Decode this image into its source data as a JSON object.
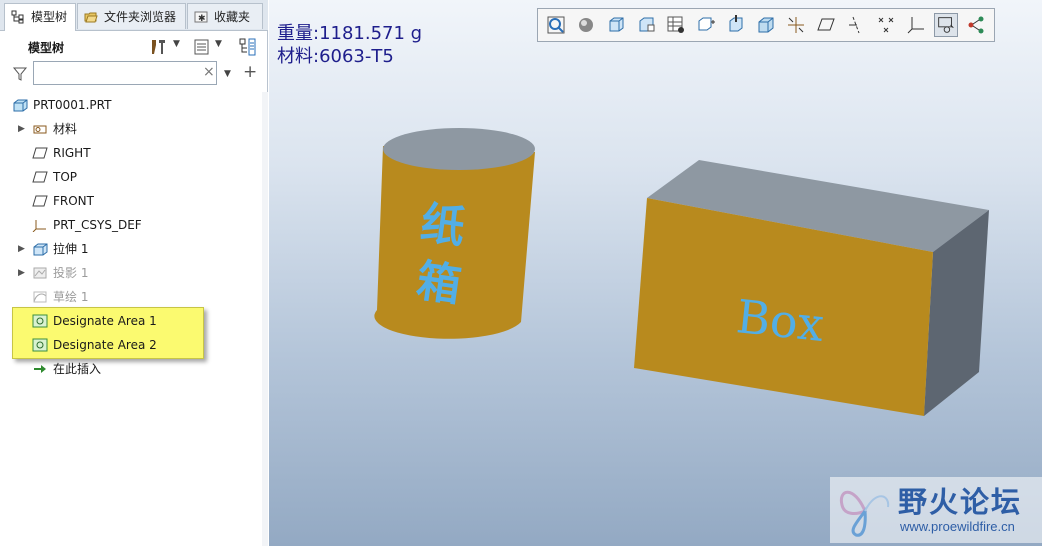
{
  "left_panel": {
    "tabs": [
      {
        "label": "模型树",
        "icon": "model-tree-icon"
      },
      {
        "label": "文件夹浏览器",
        "icon": "folder-browser-icon"
      },
      {
        "label": "收藏夹",
        "icon": "favorites-icon"
      }
    ],
    "header_title": "模型树",
    "toolbar_icons": [
      "settings-tools-icon",
      "tree-columns-icon",
      "tree-filter-display-icon"
    ],
    "search": {
      "value": "",
      "clear_symbol": "×"
    },
    "tree": {
      "root": "PRT0001.PRT",
      "items": [
        {
          "label": "材料",
          "icon": "material-icon",
          "expandable": true,
          "dim": false
        },
        {
          "label": "RIGHT",
          "icon": "datum-plane-icon",
          "expandable": false,
          "dim": false
        },
        {
          "label": "TOP",
          "icon": "datum-plane-icon",
          "expandable": false,
          "dim": false
        },
        {
          "label": "FRONT",
          "icon": "datum-plane-icon",
          "expandable": false,
          "dim": false
        },
        {
          "label": "PRT_CSYS_DEF",
          "icon": "coordinate-system-icon",
          "expandable": false,
          "dim": false
        },
        {
          "label": "拉伸 1",
          "icon": "extrude-icon",
          "expandable": true,
          "dim": false
        },
        {
          "label": "投影 1",
          "icon": "projection-icon",
          "expandable": true,
          "dim": true
        },
        {
          "label": "草绘 1",
          "icon": "sketch-icon",
          "expandable": false,
          "dim": true
        },
        {
          "label": "Designate Area 1",
          "icon": "designate-area-icon",
          "expandable": false,
          "dim": false,
          "highlighted": true
        },
        {
          "label": "Designate Area 2",
          "icon": "designate-area-icon",
          "expandable": false,
          "dim": false,
          "highlighted": true
        },
        {
          "label": "在此插入",
          "icon": "insert-here-arrow-icon",
          "expandable": false,
          "dim": false
        }
      ]
    }
  },
  "viewport": {
    "mass_label": "重量:1181.571 g",
    "material_label": "材料:6063-T5",
    "toolbar_icons": [
      "refit-zoom-icon",
      "display-style-shaded-icon",
      "saved-orientations-icon",
      "view-manager-icon",
      "appearance-gallery-icon",
      "perspective-view-icon",
      "spin-center-icon",
      "section-view-icon",
      "datum-display-filter-icon",
      "plane-display-icon",
      "axis-display-icon",
      "point-display-icon",
      "csys-display-icon",
      "annotation-display-icon",
      "network-display-icon"
    ],
    "cylinder_text": "纸箱",
    "box_text": "Box",
    "colors": {
      "body": "#b88a1e",
      "top_face": "#8e98a2",
      "side_face": "#5d6671",
      "decal_text": "#52aee6"
    }
  },
  "watermark": {
    "title": "野火论坛",
    "url": "www.proewildfire.cn"
  }
}
